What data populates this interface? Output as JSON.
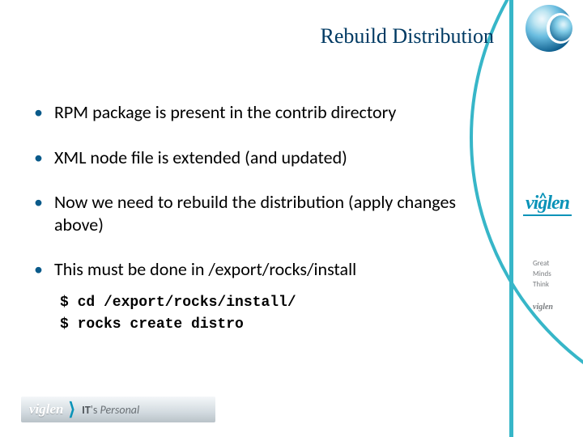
{
  "title": "Rebuild Distribution",
  "bullets": [
    "RPM package is present in the contrib directory",
    "XML node file is extended (and updated)",
    "Now we need to rebuild the distribution (apply changes above)",
    "This must be done in /export/rocks/install"
  ],
  "code": {
    "line1": "$ cd /export/rocks/install/",
    "line2": "$ rocks create distro"
  },
  "brand": {
    "name": "viglen",
    "tagline1": "Great",
    "tagline2": "Minds",
    "tagline3": "Think",
    "mini": "viglen"
  },
  "footer": {
    "brand": "viglen",
    "tag_bold": "IT",
    "tag_rest": "'s ",
    "tag_ital": "Personal"
  }
}
